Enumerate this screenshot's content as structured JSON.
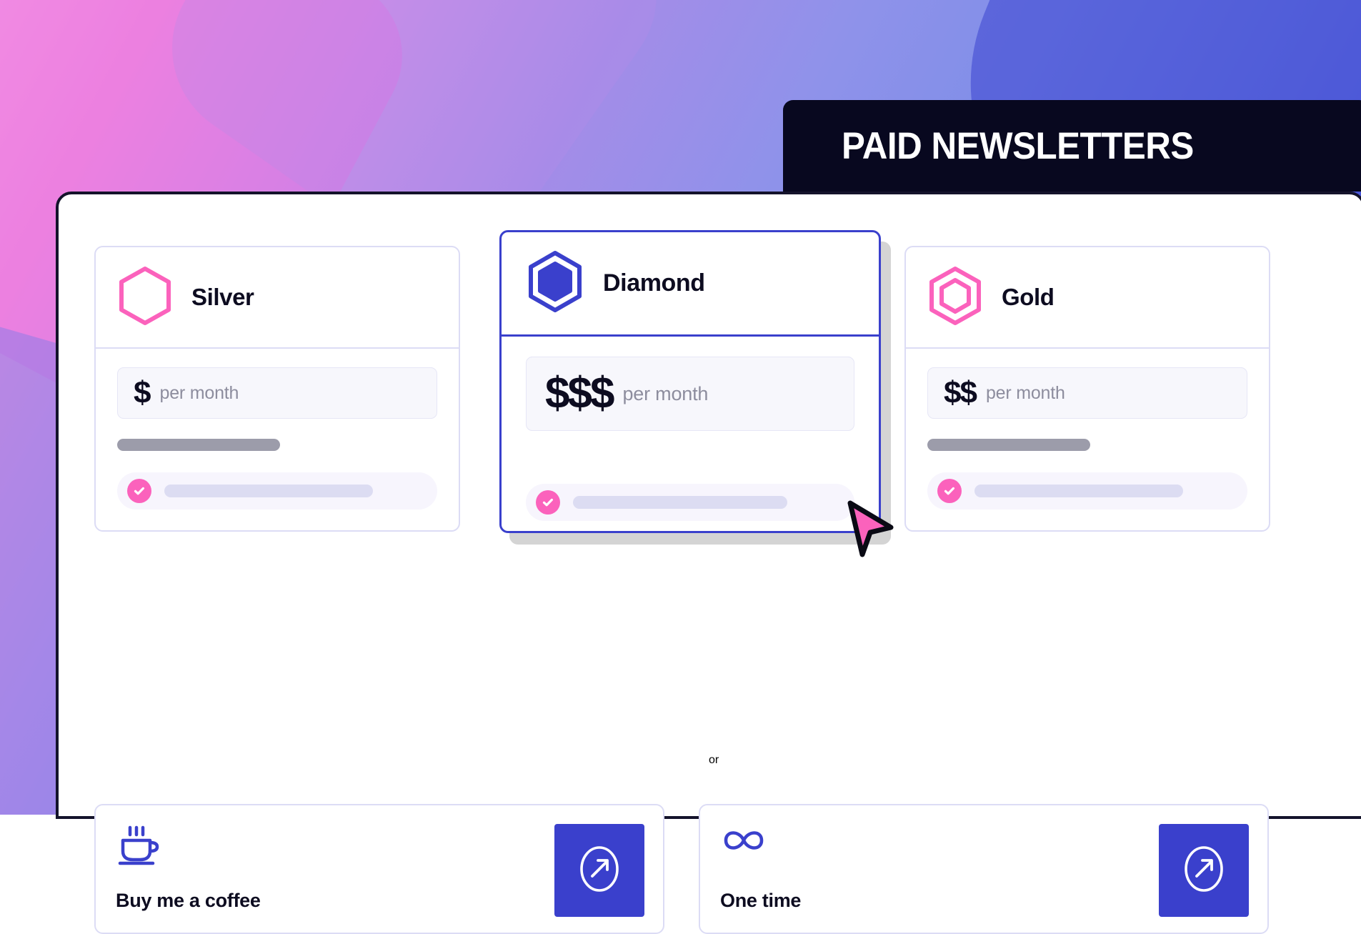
{
  "header": {
    "title": "PAID NEWSLETTERS"
  },
  "theme": {
    "pink": "#fb62bc",
    "blue": "#3a40cc",
    "dark": "#08081f",
    "card_border": "#dcdcf5",
    "price_box_bg": "#f7f7fc",
    "gray_bar": "#9c9caa",
    "feature_row_bg": "#f7f5fd",
    "feature_bar": "#dcdcf2"
  },
  "tiers": [
    {
      "name": "Silver",
      "icon": "hexagon-outline-icon",
      "icon_color": "#fb62bc",
      "price_amount": "$",
      "price_period": "per month",
      "selected": false,
      "has_gray_bar": true,
      "features": [
        {
          "icon": "check-circle-icon",
          "label": ""
        }
      ]
    },
    {
      "name": "Diamond",
      "icon": "hexagon-filled-icon",
      "icon_color": "#3a40cc",
      "price_amount": "$$$",
      "price_period": "per month",
      "selected": true,
      "has_gray_bar": false,
      "features": [
        {
          "icon": "check-circle-icon",
          "label": ""
        }
      ]
    },
    {
      "name": "Gold",
      "icon": "hexagon-double-outline-icon",
      "icon_color": "#fb62bc",
      "price_amount": "$$",
      "price_period": "per month",
      "selected": false,
      "has_gray_bar": true,
      "features": [
        {
          "icon": "check-circle-icon",
          "label": ""
        }
      ]
    }
  ],
  "divider": {
    "label": "or"
  },
  "extras": [
    {
      "label": "Buy me a coffee",
      "icon": "coffee-cup-icon",
      "action_icon": "arrow-up-right-circle-icon"
    },
    {
      "label": "One time",
      "icon": "infinity-icon",
      "action_icon": "arrow-up-right-circle-icon"
    }
  ],
  "cursor": {
    "icon": "mouse-pointer-icon",
    "color": "#fb62bc"
  }
}
